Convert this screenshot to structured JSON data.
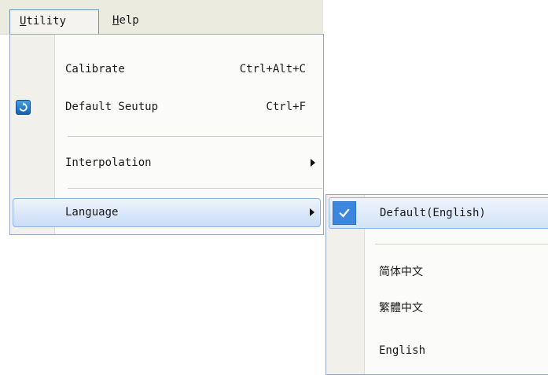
{
  "menubar": {
    "utility": {
      "mnemonic": "U",
      "rest": "tility"
    },
    "help": {
      "mnemonic": "H",
      "rest": "elp"
    }
  },
  "utility_menu": {
    "items": [
      {
        "label": "Calibrate",
        "shortcut": "Ctrl+Alt+C"
      },
      {
        "label": "Default Seutup",
        "shortcut": "Ctrl+F",
        "icon": "refresh-icon"
      },
      {
        "label": "Interpolation",
        "submenu": true
      },
      {
        "label": "Language",
        "submenu": true,
        "highlighted": true
      }
    ]
  },
  "language_menu": {
    "items": [
      {
        "label": "Default(English)",
        "checked": true
      },
      {
        "label": "简体中文"
      },
      {
        "label": "繁體中文"
      },
      {
        "label": "English"
      }
    ]
  },
  "colors": {
    "highlight": "#c9dcf5",
    "check_accent": "#3d86dd",
    "menubar_bg": "#ecebe0"
  }
}
